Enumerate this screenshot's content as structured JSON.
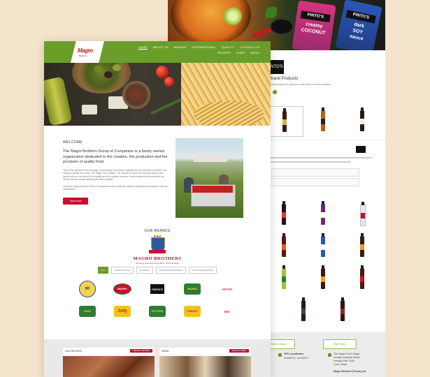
{
  "back_page": {
    "hero": {
      "bottle_1": {
        "brand": "PINTO'S",
        "line1": "creamy",
        "line2": "COCONUT"
      },
      "bottle_2": {
        "brand": "PINTO'S",
        "line1": "dark",
        "line2": "SOY",
        "line3": "sauce"
      }
    },
    "brand_logo": "PINTO'S",
    "title": "e Brand Products",
    "subtitle": "products designed for genuine local taste for every occasion",
    "footer": {
      "button_left": "Hide & Goes",
      "button_right": "360 View",
      "gps_label": "GPS coordinates",
      "gps_value": "35.8394°N, 14.5230°E",
      "address_lines": [
        "The Magro Food Village",
        "Xewkija Industrial Estate,",
        "Xewkija XWK 3000",
        "Gozo, Malta"
      ],
      "company": "Magro Brothers (Foods) Ltd"
    },
    "colors": {
      "bottles": [
        "#3a1a10",
        "#c25a12",
        "#2a1a14"
      ]
    }
  },
  "front_page": {
    "logo": {
      "name": "Magro",
      "sub": "Brothers"
    },
    "nav": [
      "HOME",
      "ABOUT US",
      "BRANDS",
      "INTERNATIONAL",
      "QUALITY",
      "CONTACT US",
      "RECIPES",
      "SHOP",
      "NEWS"
    ],
    "welcome": {
      "heading": "WELCOME",
      "lead": "The Magro Brothers Group of Companies is a family owned organization dedicated to the creation, the production and the provision of quality food.",
      "body1": "The Group operates from a through of provenance rich family conglomerate that has been involved in the supply of quality food under 'The Magro Food Village'. The passion for good food and the deep rooted family bond are reinforced in the quality and the business success of each individual who works for the Group, that are always delivering the best possible.",
      "body2": "Today the Magro Brothers Group of companies have a staff with reliable employment for people in several departments.",
      "button": "View more"
    },
    "brands": {
      "title": "OUR BRANDS",
      "name": "MAGRO BROTHERS",
      "tagline": "Achieving Success through Effort, Skill & Strategy",
      "filters": [
        "ALL",
        "MAGRO FOODS",
        "ACOGEMA",
        "CONNOISSEUR BRANDS",
        "FINE FOODS BRANDS"
      ],
      "logos": [
        {
          "name": "Three Nineties",
          "text": "90"
        },
        {
          "name": "Magro",
          "text": "MAGRO"
        },
        {
          "name": "Pinto's",
          "text": "PINTO'S"
        },
        {
          "name": "Mamma Gozo",
          "text": "MAMMA"
        },
        {
          "name": "Savina",
          "text": "SAVINA"
        },
        {
          "name": "Gozo Taste of Gozo",
          "text": "GOZO"
        },
        {
          "name": "Jolly",
          "text": "Jolly"
        },
        {
          "name": "Victoria",
          "text": "VICTORIA"
        },
        {
          "name": "Tomatoes",
          "text": "TOMATO"
        },
        {
          "name": "Bee",
          "text": "BEE"
        }
      ]
    },
    "recipes": {
      "title": "OUR RECIPES",
      "button": "VIEW ALL RECIPES"
    },
    "news": {
      "title": "NEWS",
      "button": "VIEW ALL NEWS"
    },
    "colors": {
      "primary_green": "#6b9d2b",
      "accent_red": "#c8102e",
      "brand_red": "#b0151c"
    }
  }
}
